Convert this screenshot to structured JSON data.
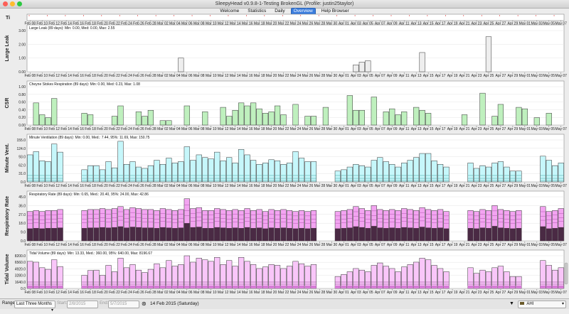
{
  "window": {
    "title": "SleepyHead v0.9.8-1-Testing BrokenGL (Profile: justin25taylor)"
  },
  "tabs": [
    "Welcome",
    "Statistics",
    "Daily",
    "Overview",
    "Help Browser"
  ],
  "active_tab": "Overview",
  "x_dates": [
    "Feb 08",
    "Feb 10",
    "Feb 12",
    "Feb 14",
    "Feb 16",
    "Feb 18",
    "Feb 20",
    "Feb 22",
    "Feb 24",
    "Feb 26",
    "Feb 28",
    "Mar 02",
    "Mar 04",
    "Mar 06",
    "Mar 08",
    "Mar 10",
    "Mar 12",
    "Mar 14",
    "Mar 16",
    "Mar 18",
    "Mar 20",
    "Mar 22",
    "Mar 24",
    "Mar 26",
    "Mar 28",
    "Mar 30",
    "Apr 01",
    "Apr 03",
    "Apr 05",
    "Apr 07",
    "Apr 09",
    "Apr 11",
    "Apr 13",
    "Apr 15",
    "Apr 17",
    "Apr 19",
    "Apr 21",
    "Apr 23",
    "Apr 25",
    "Apr 27",
    "Apr 29",
    "May 01",
    "May 03",
    "May 05",
    "May 07"
  ],
  "top_strip_label": "Ti",
  "colors": {
    "large_leak": "#eeeeee",
    "csr": "#bff0be",
    "minute_vent": "#c6f7fb",
    "resp_rate": "#f3a4f1",
    "resp_rate_dark": "#4a2a44",
    "tidal_volume": "#f9c6f9",
    "outline": "#333333",
    "teal": "#3aa1a1"
  },
  "chart_data": [
    {
      "type": "bar",
      "title": "Large Leak (89 days): Min: 0.00, Med: 0.00, Max: 2.55",
      "ylabel": "Large Leak",
      "ylim": [
        0,
        3
      ],
      "yticks": [
        "3.00",
        "2.00",
        "1.00",
        "0.00"
      ],
      "bars": [
        [
          25,
          1.0
        ],
        [
          54,
          0.5
        ],
        [
          55,
          0.7
        ],
        [
          56,
          0.8
        ],
        [
          65,
          1.4
        ],
        [
          76,
          2.55
        ]
      ]
    },
    {
      "type": "bar",
      "title": "Cheyne Stokes Respiration (89 days): Min: 0.00, Med: 0.23, Max: 1.08",
      "ylabel": "CSR",
      "ylim": [
        0,
        1.3
      ],
      "yticks": [
        "1.00",
        "0.80",
        "0.60",
        "0.40",
        "0.20",
        "0.00"
      ],
      "bars": [
        [
          1,
          0.75
        ],
        [
          2,
          0.35
        ],
        [
          3,
          0.25
        ],
        [
          4,
          0.9
        ],
        [
          9,
          0.4
        ],
        [
          10,
          0.35
        ],
        [
          14,
          0.3
        ],
        [
          15,
          0.65
        ],
        [
          18,
          0.45
        ],
        [
          19,
          0.3
        ],
        [
          20,
          0.5
        ],
        [
          22,
          0.15
        ],
        [
          23,
          0.15
        ],
        [
          26,
          0.65
        ],
        [
          29,
          0.45
        ],
        [
          32,
          0.6
        ],
        [
          33,
          0.3
        ],
        [
          34,
          0.5
        ],
        [
          35,
          0.75
        ],
        [
          36,
          0.65
        ],
        [
          37,
          0.75
        ],
        [
          38,
          0.55
        ],
        [
          39,
          0.4
        ],
        [
          40,
          0.45
        ],
        [
          41,
          0.65
        ],
        [
          42,
          0.35
        ],
        [
          44,
          0.7
        ],
        [
          46,
          0.3
        ],
        [
          47,
          0.3
        ],
        [
          49,
          0.6
        ],
        [
          53,
          1.0
        ],
        [
          54,
          0.5
        ],
        [
          55,
          0.5
        ],
        [
          57,
          0.95
        ],
        [
          59,
          0.45
        ],
        [
          60,
          0.55
        ],
        [
          61,
          0.35
        ],
        [
          62,
          0.45
        ],
        [
          64,
          0.6
        ],
        [
          65,
          0.5
        ],
        [
          66,
          0.4
        ],
        [
          72,
          0.35
        ],
        [
          75,
          1.08
        ],
        [
          77,
          0.3
        ],
        [
          78,
          0.7
        ],
        [
          81,
          0.6
        ],
        [
          82,
          0.55
        ],
        [
          84,
          0.25
        ],
        [
          86,
          0.4
        ]
      ]
    },
    {
      "type": "bar",
      "title": "Minute Ventilation (89 days): Min: 0.00, Med.: 7.44, 95%: 11.69, Max: 150.75",
      "ylabel": "Minute Vent.",
      "ylim": [
        0,
        155
      ],
      "yticks": [
        "155.0",
        "124.0",
        "93.0",
        "62.0",
        "31.0",
        "0.0"
      ],
      "bars": [
        [
          0,
          100
        ],
        [
          1,
          112
        ],
        [
          2,
          78
        ],
        [
          3,
          75
        ],
        [
          4,
          140
        ],
        [
          5,
          110
        ],
        [
          9,
          45
        ],
        [
          10,
          60
        ],
        [
          11,
          60
        ],
        [
          12,
          45
        ],
        [
          13,
          75
        ],
        [
          14,
          52
        ],
        [
          15,
          150
        ],
        [
          16,
          65
        ],
        [
          17,
          75
        ],
        [
          18,
          55
        ],
        [
          19,
          50
        ],
        [
          20,
          60
        ],
        [
          21,
          80
        ],
        [
          22,
          65
        ],
        [
          23,
          88
        ],
        [
          24,
          70
        ],
        [
          25,
          75
        ],
        [
          26,
          130
        ],
        [
          27,
          80
        ],
        [
          28,
          100
        ],
        [
          29,
          90
        ],
        [
          30,
          85
        ],
        [
          31,
          110
        ],
        [
          32,
          78
        ],
        [
          33,
          90
        ],
        [
          34,
          70
        ],
        [
          35,
          120
        ],
        [
          36,
          100
        ],
        [
          37,
          80
        ],
        [
          38,
          65
        ],
        [
          39,
          70
        ],
        [
          40,
          82
        ],
        [
          41,
          78
        ],
        [
          42,
          65
        ],
        [
          43,
          70
        ],
        [
          44,
          112
        ],
        [
          45,
          88
        ],
        [
          46,
          75
        ],
        [
          47,
          75
        ],
        [
          51,
          40
        ],
        [
          52,
          45
        ],
        [
          53,
          55
        ],
        [
          54,
          65
        ],
        [
          55,
          60
        ],
        [
          56,
          55
        ],
        [
          57,
          80
        ],
        [
          58,
          90
        ],
        [
          59,
          75
        ],
        [
          60,
          65
        ],
        [
          61,
          55
        ],
        [
          62,
          70
        ],
        [
          63,
          80
        ],
        [
          64,
          90
        ],
        [
          65,
          105
        ],
        [
          66,
          105
        ],
        [
          67,
          78
        ],
        [
          68,
          65
        ],
        [
          69,
          55
        ],
        [
          73,
          70
        ],
        [
          74,
          50
        ],
        [
          75,
          60
        ],
        [
          76,
          55
        ],
        [
          77,
          70
        ],
        [
          78,
          75
        ],
        [
          79,
          55
        ],
        [
          80,
          40
        ],
        [
          81,
          40
        ],
        [
          85,
          95
        ],
        [
          86,
          80
        ],
        [
          87,
          60
        ],
        [
          88,
          70
        ]
      ]
    },
    {
      "type": "bar",
      "title": "Respiratory Rate (89 days): Min: 0.65, Med.: 20.40, 95%: 24.00, Max: 42.86",
      "ylabel": "Respiratory Rate",
      "ylim": [
        0,
        45
      ],
      "yticks": [
        "45.0",
        "36.0",
        "27.0",
        "18.0",
        "9.0",
        "0.0"
      ],
      "bars": [
        [
          0,
          30
        ],
        [
          1,
          31
        ],
        [
          2,
          30
        ],
        [
          3,
          31
        ],
        [
          4,
          31
        ],
        [
          5,
          32
        ],
        [
          9,
          31
        ],
        [
          10,
          32
        ],
        [
          11,
          32
        ],
        [
          12,
          33
        ],
        [
          13,
          32
        ],
        [
          14,
          33
        ],
        [
          15,
          35
        ],
        [
          16,
          32
        ],
        [
          17,
          34
        ],
        [
          18,
          33
        ],
        [
          19,
          32
        ],
        [
          20,
          32
        ],
        [
          21,
          31
        ],
        [
          22,
          33
        ],
        [
          23,
          32
        ],
        [
          24,
          31
        ],
        [
          25,
          32
        ],
        [
          26,
          43
        ],
        [
          27,
          33
        ],
        [
          28,
          34
        ],
        [
          29,
          31
        ],
        [
          30,
          31
        ],
        [
          31,
          33
        ],
        [
          32,
          32
        ],
        [
          33,
          31
        ],
        [
          34,
          32
        ],
        [
          35,
          31
        ],
        [
          36,
          33
        ],
        [
          37,
          31
        ],
        [
          38,
          32
        ],
        [
          39,
          30
        ],
        [
          40,
          32
        ],
        [
          41,
          31
        ],
        [
          42,
          32
        ],
        [
          43,
          31
        ],
        [
          44,
          30
        ],
        [
          45,
          31
        ],
        [
          46,
          30
        ],
        [
          47,
          31
        ],
        [
          51,
          30
        ],
        [
          52,
          31
        ],
        [
          53,
          32
        ],
        [
          54,
          35
        ],
        [
          55,
          33
        ],
        [
          56,
          31
        ],
        [
          57,
          36
        ],
        [
          58,
          32
        ],
        [
          59,
          31
        ],
        [
          60,
          32
        ],
        [
          61,
          31
        ],
        [
          62,
          33
        ],
        [
          63,
          32
        ],
        [
          64,
          31
        ],
        [
          65,
          34
        ],
        [
          66,
          32
        ],
        [
          67,
          31
        ],
        [
          68,
          32
        ],
        [
          69,
          30
        ],
        [
          73,
          31
        ],
        [
          74,
          30
        ],
        [
          75,
          32
        ],
        [
          76,
          31
        ],
        [
          77,
          36
        ],
        [
          78,
          32
        ],
        [
          79,
          31
        ],
        [
          80,
          30
        ],
        [
          81,
          31
        ],
        [
          85,
          35
        ],
        [
          86,
          30
        ],
        [
          87,
          31
        ],
        [
          88,
          33
        ]
      ]
    },
    {
      "type": "bar",
      "title": "Tidal Volume (89 days): Min: 13.33, Med.: 360.00, 95%: 640.00, Max: 8196.67",
      "ylabel": "Tidal Volume",
      "ylim": [
        0,
        8200
      ],
      "yticks": [
        "8200.0",
        "6560.0",
        "4920.0",
        "3280.0",
        "1640.0",
        "0.0"
      ],
      "bars": [
        [
          0,
          6800
        ],
        [
          1,
          6600
        ],
        [
          2,
          5200
        ],
        [
          3,
          4800
        ],
        [
          4,
          7200
        ],
        [
          5,
          5500
        ],
        [
          9,
          3300
        ],
        [
          10,
          4500
        ],
        [
          11,
          4600
        ],
        [
          12,
          3300
        ],
        [
          13,
          5800
        ],
        [
          14,
          4200
        ],
        [
          15,
          7600
        ],
        [
          16,
          5200
        ],
        [
          17,
          6000
        ],
        [
          18,
          4600
        ],
        [
          19,
          4000
        ],
        [
          20,
          4800
        ],
        [
          21,
          6200
        ],
        [
          22,
          5200
        ],
        [
          23,
          7000
        ],
        [
          24,
          5600
        ],
        [
          25,
          6000
        ],
        [
          26,
          8196
        ],
        [
          27,
          6600
        ],
        [
          28,
          7600
        ],
        [
          29,
          7200
        ],
        [
          30,
          6800
        ],
        [
          31,
          7800
        ],
        [
          32,
          6000
        ],
        [
          33,
          7000
        ],
        [
          34,
          5600
        ],
        [
          35,
          7800
        ],
        [
          36,
          6800
        ],
        [
          37,
          6000
        ],
        [
          38,
          5000
        ],
        [
          39,
          5400
        ],
        [
          40,
          6000
        ],
        [
          41,
          5800
        ],
        [
          42,
          5000
        ],
        [
          43,
          5600
        ],
        [
          44,
          6800
        ],
        [
          45,
          6200
        ],
        [
          46,
          5600
        ],
        [
          47,
          6000
        ],
        [
          51,
          3000
        ],
        [
          52,
          3500
        ],
        [
          53,
          4200
        ],
        [
          54,
          5000
        ],
        [
          55,
          4600
        ],
        [
          56,
          4200
        ],
        [
          57,
          5800
        ],
        [
          58,
          6400
        ],
        [
          59,
          5600
        ],
        [
          60,
          5000
        ],
        [
          61,
          4200
        ],
        [
          62,
          5400
        ],
        [
          63,
          6000
        ],
        [
          64,
          6600
        ],
        [
          65,
          7600
        ],
        [
          66,
          7200
        ],
        [
          67,
          5800
        ],
        [
          68,
          5000
        ],
        [
          69,
          4200
        ],
        [
          73,
          5200
        ],
        [
          74,
          3800
        ],
        [
          75,
          4600
        ],
        [
          76,
          4200
        ],
        [
          77,
          5200
        ],
        [
          78,
          5600
        ],
        [
          79,
          4200
        ],
        [
          80,
          3000
        ],
        [
          81,
          3000
        ],
        [
          85,
          7000
        ],
        [
          86,
          5800
        ],
        [
          87,
          4600
        ],
        [
          88,
          5200
        ]
      ]
    }
  ],
  "bottom": {
    "range_label": "Range:",
    "range_value": "Last Three Months",
    "start_label": "Start:",
    "start_value": "2/8/2015",
    "end_label": "End:",
    "end_value": "5/7/2015",
    "current_date": "14 Feb 2015 (Saturday)",
    "graph_selector": "AHI"
  }
}
